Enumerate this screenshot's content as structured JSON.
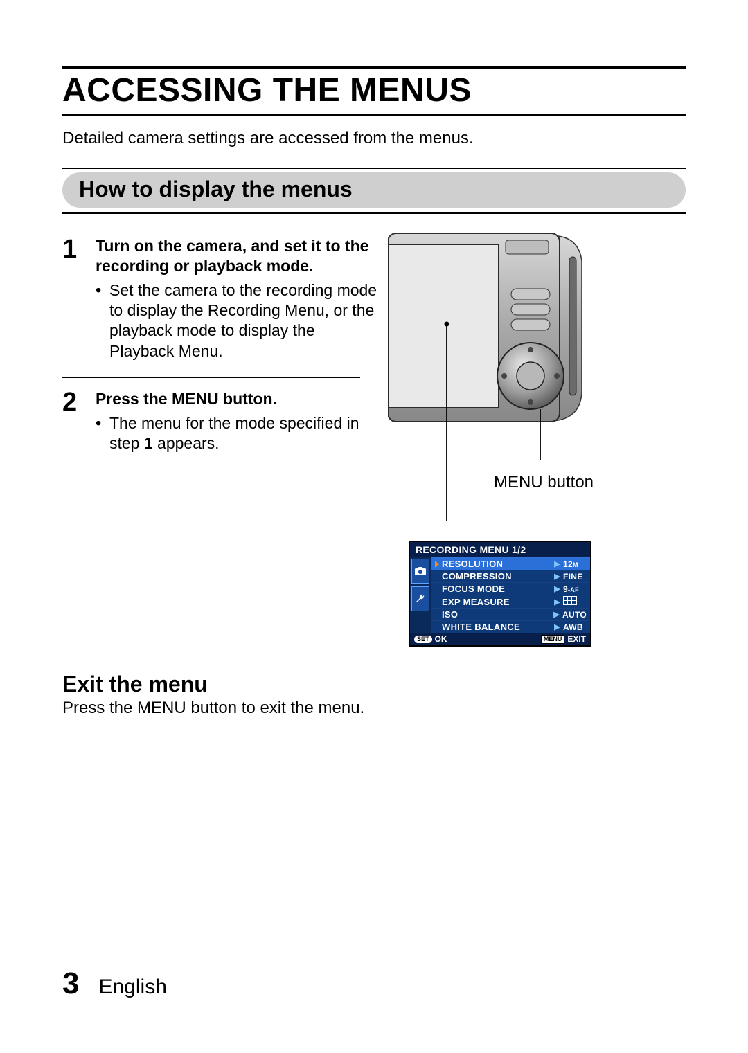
{
  "title": "ACCESSING THE MENUS",
  "intro": "Detailed camera settings are accessed from the menus.",
  "section_heading": "How to display the menus",
  "steps": [
    {
      "num": "1",
      "head": "Turn on the camera, and set it to the recording or playback mode.",
      "detail": "Set the camera to the recording mode to display the Recording Menu, or the playback mode to display the Playback Menu."
    },
    {
      "num": "2",
      "head": "Press the MENU button.",
      "detail_pre": "The menu for the mode specified in step ",
      "detail_bold": "1",
      "detail_post": " appears."
    }
  ],
  "callout_label": "MENU button",
  "exit": {
    "title": "Exit the menu",
    "text": "Press the MENU button to exit the menu."
  },
  "footer": {
    "page_num": "3",
    "language": "English"
  },
  "menu": {
    "title": "RECORDING MENU 1/2",
    "rows": [
      {
        "label": "RESOLUTION",
        "value_main": "12",
        "value_sub": "M",
        "selected": true
      },
      {
        "label": "COMPRESSION",
        "value": "FINE"
      },
      {
        "label": "FOCUS MODE",
        "value_main": "9",
        "value_sub": "-AF"
      },
      {
        "label": "EXP MEASURE",
        "value_icon": "grid"
      },
      {
        "label": "ISO",
        "value": "AUTO"
      },
      {
        "label": "WHITE BALANCE",
        "value": "AWB"
      }
    ],
    "footer_ok_chip": "SET",
    "footer_ok": "OK",
    "footer_exit_chip": "MENU",
    "footer_exit": "EXIT"
  }
}
